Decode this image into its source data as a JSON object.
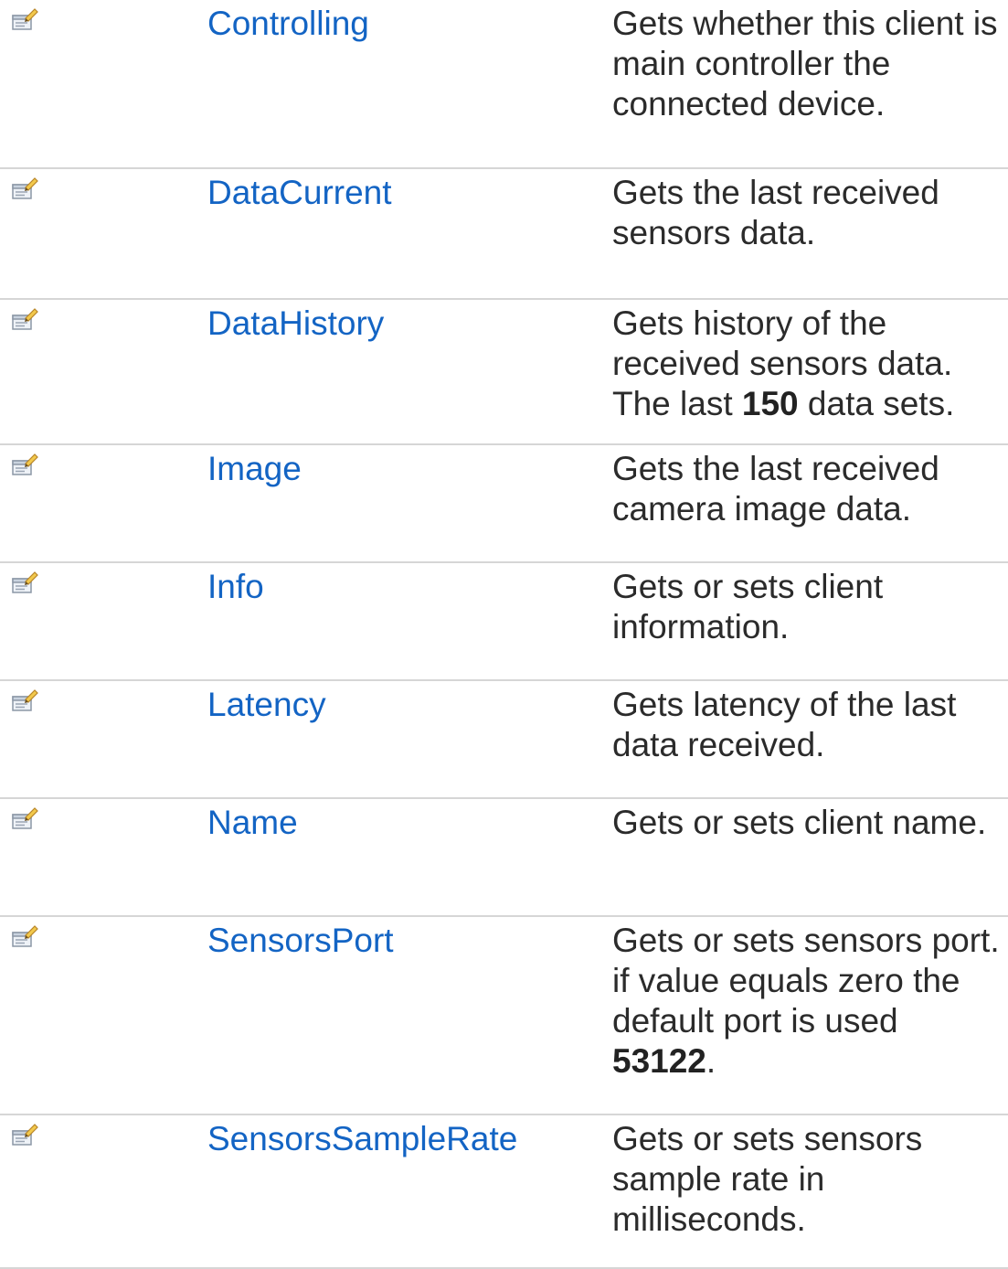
{
  "members": [
    {
      "name": "Controlling",
      "description": [
        {
          "text": "Gets whether this client is main controller the connected device.",
          "bold": false
        }
      ]
    },
    {
      "name": "DataCurrent",
      "description": [
        {
          "text": "Gets the last received sensors data.",
          "bold": false
        }
      ]
    },
    {
      "name": "DataHistory",
      "description": [
        {
          "text": "Gets history of the received sensors data. The last ",
          "bold": false
        },
        {
          "text": "150",
          "bold": true
        },
        {
          "text": " data sets.",
          "bold": false
        }
      ]
    },
    {
      "name": "Image",
      "description": [
        {
          "text": "Gets the last received camera image data.",
          "bold": false
        }
      ]
    },
    {
      "name": "Info",
      "description": [
        {
          "text": "Gets or sets client information.",
          "bold": false
        }
      ]
    },
    {
      "name": "Latency",
      "description": [
        {
          "text": "Gets latency of the last data received.",
          "bold": false
        }
      ]
    },
    {
      "name": "Name",
      "description": [
        {
          "text": "Gets or sets client name.",
          "bold": false
        }
      ]
    },
    {
      "name": "SensorsPort",
      "description": [
        {
          "text": "Gets or sets sensors port. if value equals zero the default port is used ",
          "bold": false
        },
        {
          "text": "53122",
          "bold": true
        },
        {
          "text": ".",
          "bold": false
        }
      ]
    },
    {
      "name": "SensorsSampleRate",
      "description": [
        {
          "text": "Gets or sets sensors sample rate in milliseconds.",
          "bold": false
        }
      ]
    }
  ],
  "icon": "property-icon",
  "colors": {
    "link": "#1364c4",
    "text": "#2b2b2b",
    "divider": "#d6d6d6"
  }
}
